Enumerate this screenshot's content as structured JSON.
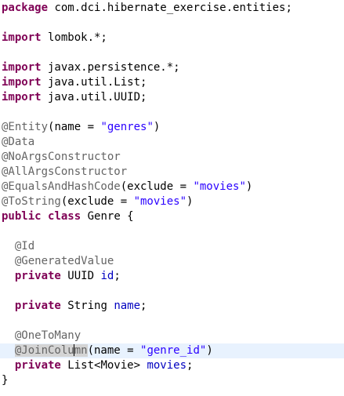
{
  "editor": {
    "line1": {
      "kw": "package",
      "rest": " com.dci.hibernate_exercise.entities;"
    },
    "line3": {
      "kw": "import",
      "rest": " lombok.*;"
    },
    "line5": {
      "kw": "import",
      "rest": " javax.persistence.*;"
    },
    "line6": {
      "kw": "import",
      "rest": " java.util.List;"
    },
    "line7": {
      "kw": "import",
      "rest": " java.util.UUID;"
    },
    "line9": {
      "ann": "@Entity",
      "pre": "(name = ",
      "str": "\"genres\"",
      "post": ")"
    },
    "line10": {
      "ann": "@Data"
    },
    "line11": {
      "ann": "@NoArgsConstructor"
    },
    "line12": {
      "ann": "@AllArgsConstructor"
    },
    "line13": {
      "ann": "@EqualsAndHashCode",
      "pre": "(exclude = ",
      "str": "\"movies\"",
      "post": ")"
    },
    "line14": {
      "ann": "@ToString",
      "pre": "(exclude = ",
      "str": "\"movies\"",
      "post": ")"
    },
    "line15": {
      "kw1": "public",
      "kw2": "class",
      "rest": " Genre {"
    },
    "line17": {
      "ann": "@Id"
    },
    "line18": {
      "ann": "@GeneratedValue"
    },
    "line19": {
      "kw": "private",
      "rest": " UUID ",
      "field": "id",
      "post": ";"
    },
    "line21": {
      "kw": "private",
      "rest": " String ",
      "field": "name",
      "post": ";"
    },
    "line23": {
      "ann": "@OneToMany"
    },
    "line24": {
      "ann_a": "@JoinColu",
      "ann_b": "mn",
      "pre": "(name = ",
      "str": "\"genre_id\"",
      "post": ")"
    },
    "line25": {
      "kw": "private",
      "rest": " List<Movie> ",
      "field": "movies",
      "post": ";"
    },
    "line26": {
      "rest": "}"
    }
  }
}
